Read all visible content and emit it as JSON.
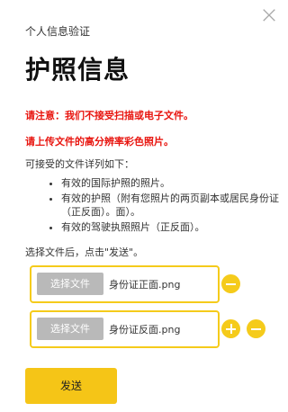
{
  "dialog": {
    "close_symbol": "×",
    "subtitle": "个人信息验证",
    "title": "护照信息",
    "warning_1": "请注意：我们不接受扫描或电子文件。",
    "warning_2": "请上传文件的高分辨率彩色照片。",
    "intro": "可接受的文件详列如下：",
    "documents": [
      "有效的国际护照的照片。",
      "有效的护照（附有您照片的两页副本或居民身份证（正反面）。面）。",
      "有效的驾驶执照照片（正反面）。"
    ],
    "after_select": "选择文件后，点击\"发送\"。"
  },
  "uploads": [
    {
      "button_label": "选择文件",
      "file_name": "身份证正面.png"
    },
    {
      "button_label": "选择文件",
      "file_name": "身份证反面.png"
    }
  ],
  "send_button": "发送",
  "colors": {
    "accent": "#f5cb1b",
    "warning": "#e8150f",
    "button_gray": "#b9b9b9"
  },
  "icons": {
    "close": "close-icon",
    "add": "plus-circle-icon",
    "remove": "minus-circle-icon"
  }
}
